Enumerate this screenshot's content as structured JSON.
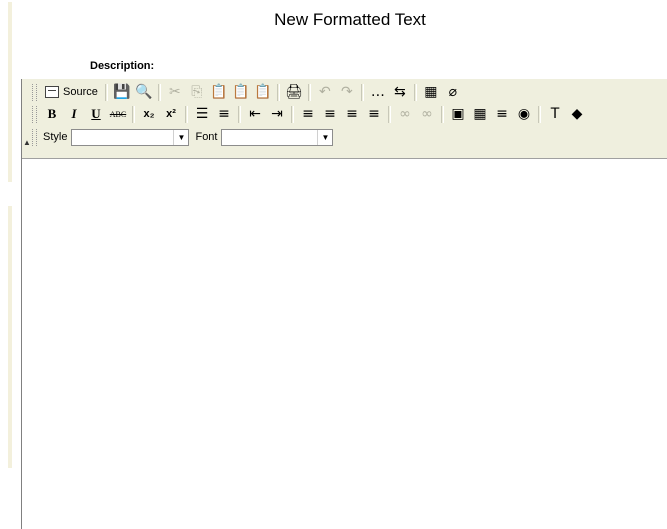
{
  "page": {
    "title": "New Formatted Text"
  },
  "form": {
    "description_label": "Description:"
  },
  "toolbar": {
    "source_label": "Source",
    "style_label": "Style",
    "font_label": "Font",
    "style_value": "",
    "font_value": ""
  },
  "icons": {
    "save": "💾",
    "preview": "🔍",
    "cut": "✂",
    "copy": "⎘",
    "paste": "📋",
    "paste_text": "📋",
    "paste_word": "📋",
    "print": "🖨",
    "undo": "↶",
    "redo": "↷",
    "find": "…",
    "replace": "⇆",
    "select_all": "▦",
    "remove_format": "⌀",
    "bold": "B",
    "italic": "I",
    "underline": "U",
    "strike": "ABC",
    "subscript": "x₂",
    "superscript": "x²",
    "ordered_list": "☰",
    "unordered_list": "≡",
    "outdent": "⇤",
    "indent": "⇥",
    "align_left": "≡",
    "align_center": "≡",
    "align_right": "≡",
    "justify": "≡",
    "link": "∞",
    "unlink": "∞",
    "image": "▣",
    "table": "▦",
    "hr": "≡",
    "special": "◉",
    "text_color": "T",
    "bg_color": "◆",
    "collapse": "▲",
    "dropdown": "▼"
  },
  "colors": {
    "toolbar_bg": "#efefde",
    "left_strip": "#f3f0dc",
    "disabled": "#b0b0a0"
  }
}
